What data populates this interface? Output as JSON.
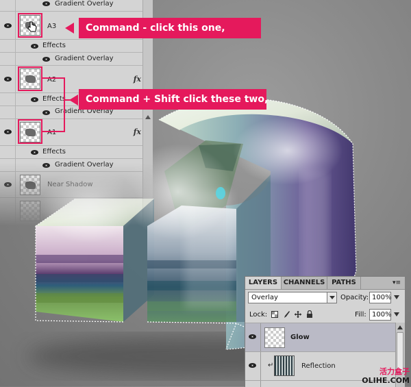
{
  "left_panel": {
    "top_row": {
      "label": "Gradient Overlay"
    },
    "layers": [
      {
        "name": "A3",
        "effects_label": "Effects",
        "effect": "Gradient Overlay"
      },
      {
        "name": "A2",
        "fx": "fx",
        "effects_label": "Effects",
        "effect": "Gradient Overlay"
      },
      {
        "name": "A1",
        "fx": "fx",
        "effects_label": "Effects",
        "effect": "Gradient Overlay"
      }
    ],
    "near_shadow": {
      "name": "Near Shadow"
    }
  },
  "callouts": {
    "first": "Command - click this one,",
    "second": "Command + Shift click these two,"
  },
  "right_panel": {
    "tabs": [
      "LAYERS",
      "CHANNELS",
      "PATHS"
    ],
    "blend_mode": "Overlay",
    "opacity_label": "Opacity:",
    "opacity_value": "100%",
    "lock_label": "Lock:",
    "fill_label": "Fill:",
    "fill_value": "100%",
    "layers": [
      {
        "name": "Glow"
      },
      {
        "name": "Reflection"
      }
    ]
  },
  "watermark": {
    "cn": "活力盒子",
    "en": "OLIHE.COM"
  },
  "colors": {
    "accent": "#e5195c",
    "panel": "#d4d4d4",
    "selected_row": "#babac6"
  }
}
